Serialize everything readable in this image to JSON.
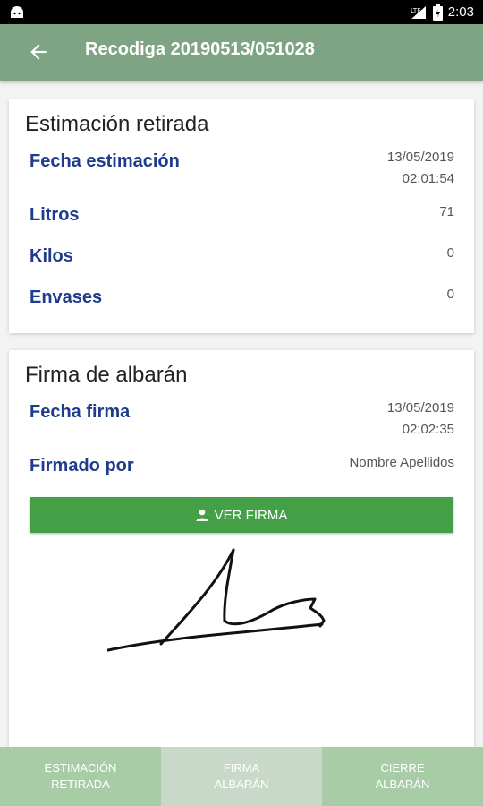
{
  "status_bar": {
    "time": "2:03",
    "network": "LTE"
  },
  "app_bar": {
    "title": "Recodiga 20190513/051028"
  },
  "estimacion": {
    "title": "Estimación retirada",
    "rows": [
      {
        "label": "Fecha estimación",
        "value_line1": "13/05/2019",
        "value_line2": "02:01:54"
      },
      {
        "label": "Litros",
        "value": "71"
      },
      {
        "label": "Kilos",
        "value": "0"
      },
      {
        "label": "Envases",
        "value": "0"
      }
    ]
  },
  "firma": {
    "title": "Firma de albarán",
    "fecha_label": "Fecha firma",
    "fecha_line1": "13/05/2019",
    "fecha_line2": "02:02:35",
    "firmado_label": "Firmado por",
    "firmado_value": "Nombre Apellidos",
    "button_label": "VER FIRMA"
  },
  "bottom_nav": {
    "tabs": [
      {
        "label": "ESTIMACIÓN\nRETIRADA"
      },
      {
        "label": "FIRMA\nALBARÁN"
      },
      {
        "label": "CIERRE\nALBARÁN"
      }
    ]
  },
  "colors": {
    "app_bar": "#7ea483",
    "button": "#43a047",
    "label": "#1e3c8c",
    "tab": "#a7cca6",
    "tab_selected": "#c9d9c9"
  }
}
